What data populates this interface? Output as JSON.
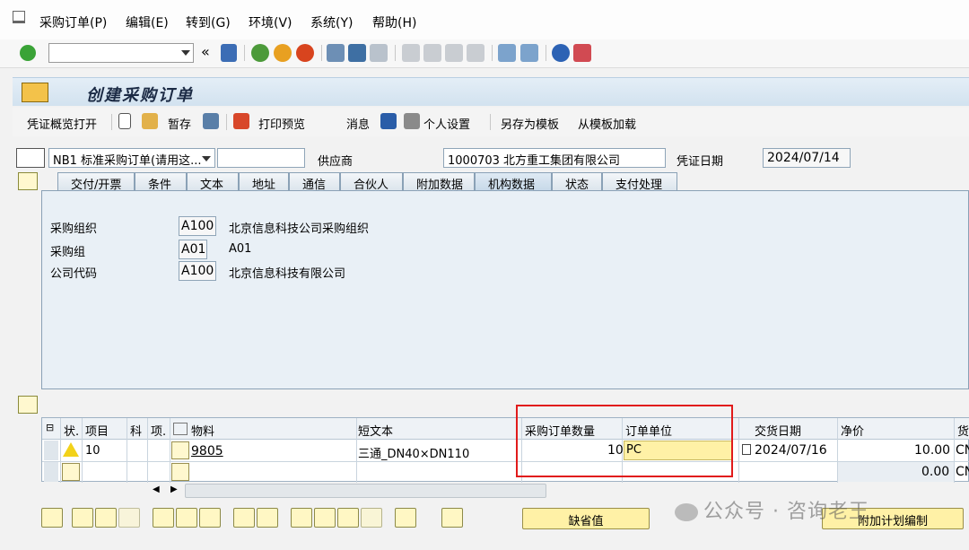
{
  "menubar": {
    "items": [
      "采购订单(P)",
      "编辑(E)",
      "转到(G)",
      "环境(V)",
      "系统(Y)",
      "帮助(H)"
    ]
  },
  "toolbar": {
    "command_field_value": "",
    "back_glyph": "«"
  },
  "window": {
    "title": "创建采购订单"
  },
  "app_toolbar": {
    "document_overview": "凭证概览打开",
    "hold": "暂存",
    "print_preview": "打印预览",
    "messages": "消息",
    "personal_settings": "个人设置",
    "save_as_template": "另存为模板",
    "load_from_template": "从模板加载"
  },
  "header": {
    "order_type": "NB1 标准采购订单(请用这...",
    "order_type_extra": "",
    "vendor_label": "供应商",
    "vendor_value": "1000703 北方重工集团有限公司",
    "doc_date_label": "凭证日期",
    "doc_date_value": "2024/07/14"
  },
  "tabs": [
    "交付/开票",
    "条件",
    "文本",
    "地址",
    "通信",
    "合伙人",
    "附加数据",
    "机构数据",
    "状态",
    "支付处理"
  ],
  "active_tab": "机构数据",
  "org_data": {
    "purch_org_label": "采购组织",
    "purch_org_value": "A100",
    "purch_org_text": "北京信息科技公司采购组织",
    "purch_group_label": "采购组",
    "purch_group_value": "A01",
    "purch_group_text": "A01",
    "company_code_label": "公司代码",
    "company_code_value": "A100",
    "company_code_text": "北京信息科技有限公司"
  },
  "items_table": {
    "columns": [
      "状.",
      "项目",
      "科",
      "项.",
      "物料",
      "短文本",
      "采购订单数量",
      "订单单位",
      "交货日期",
      "净价",
      "货"
    ],
    "rows": [
      {
        "item": "10",
        "material": "9805",
        "short_text": "三通_DN40×DN110",
        "quantity": "10",
        "unit": "PC",
        "delivery_date": "2024/07/16",
        "net_price": "10.00",
        "currency": "CN"
      },
      {
        "item": "",
        "material": "",
        "short_text": "",
        "quantity": "",
        "unit": "",
        "delivery_date": "",
        "net_price": "0.00",
        "currency": "CN"
      }
    ]
  },
  "bottom": {
    "default_values_btn": "缺省值",
    "add_planning_btn": "附加计划编制"
  },
  "watermark": "公众号 · 咨询老王",
  "colors": {
    "highlight_box": "#e11b1b",
    "panel_bg": "#e9f0f6",
    "active_cell": "#fff1a6"
  }
}
